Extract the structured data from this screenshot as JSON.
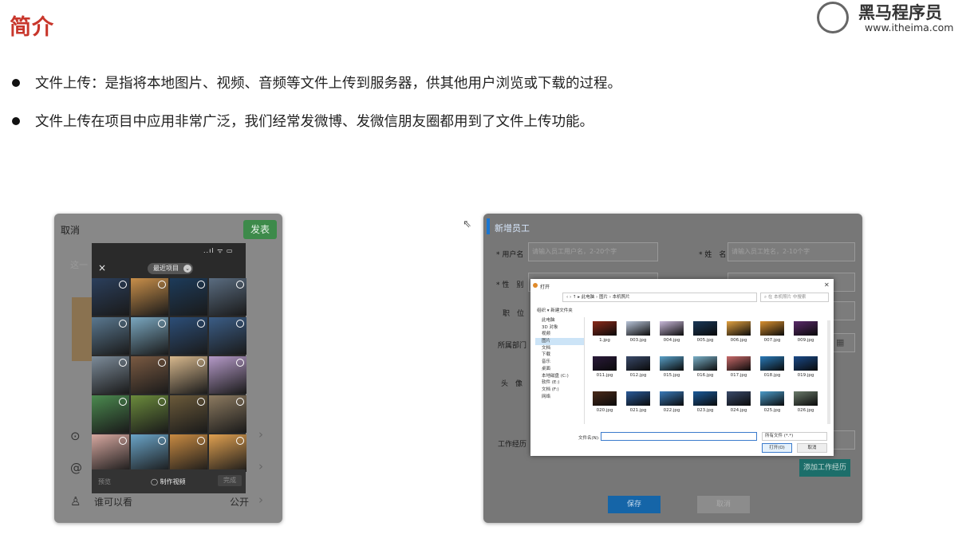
{
  "slide": {
    "title": "简介",
    "logo": {
      "name": "黑马程序员",
      "url": "www.itheima.com"
    },
    "bullets": [
      "文件上传：是指将本地图片、视频、音频等文件上传到服务器，供其他用户浏览或下载的过程。",
      "文件上传在项目中应用非常广泛，我们经常发微博、发微信朋友圈都用到了文件上传功能。"
    ]
  },
  "phone": {
    "cancel": "取消",
    "post": "发表",
    "hint": "这一",
    "picker": {
      "status": "..ıl ᯤ ▭",
      "close": "×",
      "album": "最近项目",
      "preview": "预览",
      "make_video": "◯ 制作视频",
      "send": "完成"
    },
    "rows": [
      {
        "icon": "location-icon",
        "glyph": "⊙",
        "label": "",
        "value": ""
      },
      {
        "icon": "mention-icon",
        "glyph": "@",
        "label": "",
        "value": ""
      },
      {
        "icon": "person-icon",
        "glyph": "♙",
        "label": "谁可以看",
        "value": "公开"
      }
    ],
    "chevron": "›",
    "thumbs": [
      "#2b3f5c",
      "#c98f4a",
      "#1d3b5a",
      "#5a6c80",
      "#5a7890",
      "#7aa7c0",
      "#2c4e78",
      "#3b5d86",
      "#7d8c9a",
      "#7a5a42",
      "#d7b88d",
      "#b59ac8",
      "#4b8a4f",
      "#6b8b3c",
      "#6b5a3a",
      "#8c7a60",
      "#d7a8a0",
      "#6aa4c8",
      "#c88a42",
      "#e0a050"
    ]
  },
  "form": {
    "title": "新增员工",
    "fields": {
      "username_label": "* 用户名",
      "username_placeholder": "请输入员工用户名，2-20个字",
      "name_label": "* 姓　名",
      "name_placeholder": "请输入员工姓名，2-10个字",
      "gender_label": "* 性　别",
      "position_label": "职　位",
      "dept_label": "所属部门",
      "avatar_label": "头　像",
      "experience_label": "工作经历"
    },
    "add_experience": "添加工作经历",
    "save": "保存",
    "cancel": "取消",
    "calendar_glyph": "▦"
  },
  "dialog": {
    "title": "打开",
    "close": "✕",
    "path": "‹  ›  ↑  ▸ 此电脑 › 图片 › 本机照片",
    "search": "⌕ 在 本机照片 中搜索",
    "toolbar": "组织 ▾      新建文件夹",
    "sidebar": [
      "此电脑",
      "3D 对象",
      "视频",
      "图片",
      "文档",
      "下载",
      "音乐",
      "桌面",
      "本地磁盘 (C:)",
      "软件 (E:)",
      "文档 (F:)",
      "网络"
    ],
    "selected_index": 3,
    "files": [
      {
        "name": "1.jpg",
        "color": "#8a2a1a"
      },
      {
        "name": "003.jpg",
        "color": "#b8c4d8"
      },
      {
        "name": "004.jpg",
        "color": "#c8b8d8"
      },
      {
        "name": "005.jpg",
        "color": "#1a3858"
      },
      {
        "name": "006.jpg",
        "color": "#e0a040"
      },
      {
        "name": "007.jpg",
        "color": "#d89030"
      },
      {
        "name": "009.jpg",
        "color": "#5a2a6a"
      },
      {
        "name": "011.jpg",
        "color": "#2a1a3a"
      },
      {
        "name": "012.jpg",
        "color": "#3a4a6a"
      },
      {
        "name": "015.jpg",
        "color": "#5aa0c8"
      },
      {
        "name": "016.jpg",
        "color": "#7ab0c8"
      },
      {
        "name": "017.jpg",
        "color": "#c86a6a"
      },
      {
        "name": "018.jpg",
        "color": "#2a7ab8"
      },
      {
        "name": "019.jpg",
        "color": "#1a4a88"
      },
      {
        "name": "020.jpg",
        "color": "#4a2a1a"
      },
      {
        "name": "021.jpg",
        "color": "#2a5a98"
      },
      {
        "name": "022.jpg",
        "color": "#3a7ab8"
      },
      {
        "name": "023.jpg",
        "color": "#1a5a9a"
      },
      {
        "name": "024.jpg",
        "color": "#3a4a6a"
      },
      {
        "name": "025.jpg",
        "color": "#4a9ac8"
      },
      {
        "name": "026.jpg",
        "color": "#6a7a6a"
      }
    ],
    "filename_label": "文件名(N):",
    "filetype": "所有文件 (*.*)",
    "open": "打开(O)",
    "cancel": "取消"
  },
  "cursor": "⇖"
}
